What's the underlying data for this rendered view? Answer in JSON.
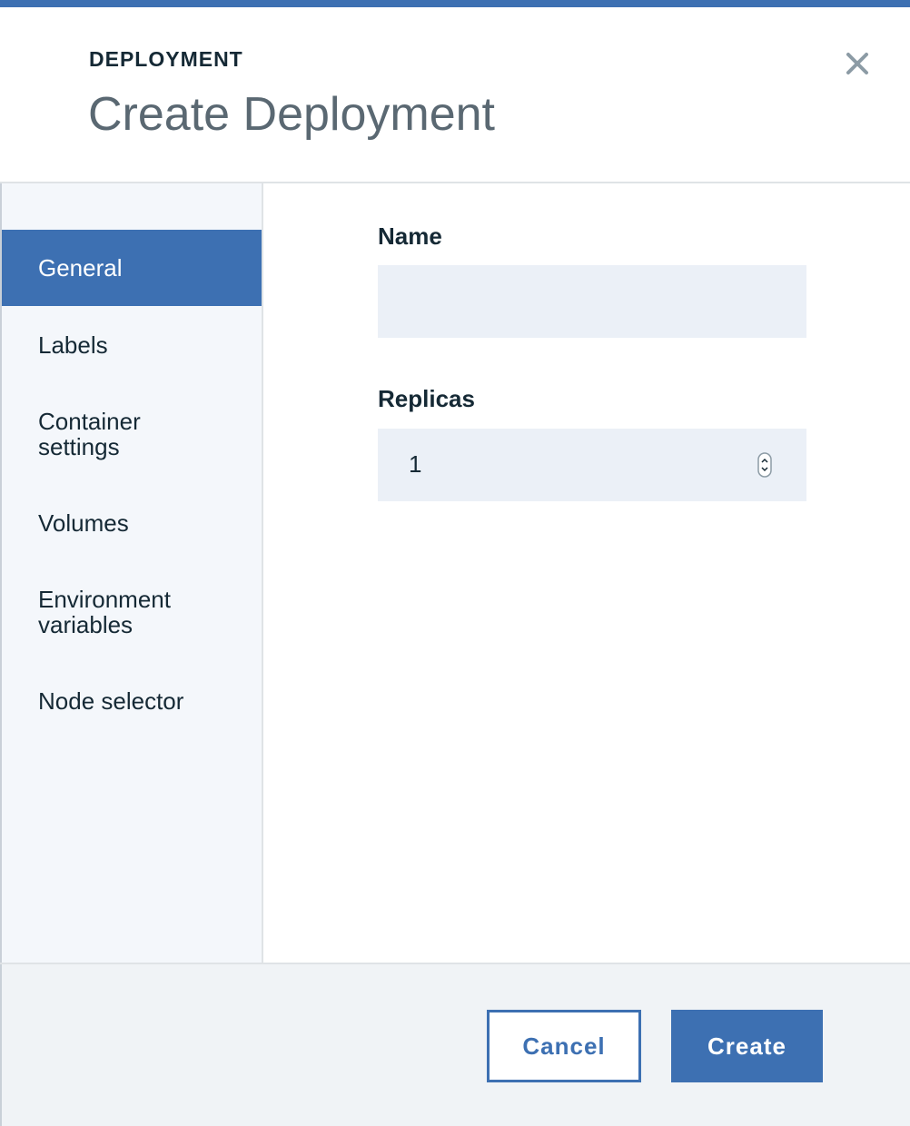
{
  "dialog": {
    "label": "DEPLOYMENT",
    "title": "Create Deployment",
    "close_icon": "close-icon",
    "accent_color": "#3d70b2"
  },
  "sidebar": {
    "items": [
      {
        "label": "General",
        "active": true
      },
      {
        "label": "Labels",
        "active": false
      },
      {
        "label": "Container settings",
        "active": false
      },
      {
        "label": "Volumes",
        "active": false
      },
      {
        "label": "Environment variables",
        "active": false
      },
      {
        "label": "Node selector",
        "active": false
      }
    ]
  },
  "form": {
    "name": {
      "label": "Name",
      "value": "",
      "placeholder": ""
    },
    "replicas": {
      "label": "Replicas",
      "value": "1",
      "spinner_icon": "spinner-icon"
    }
  },
  "footer": {
    "cancel_label": "Cancel",
    "create_label": "Create"
  }
}
